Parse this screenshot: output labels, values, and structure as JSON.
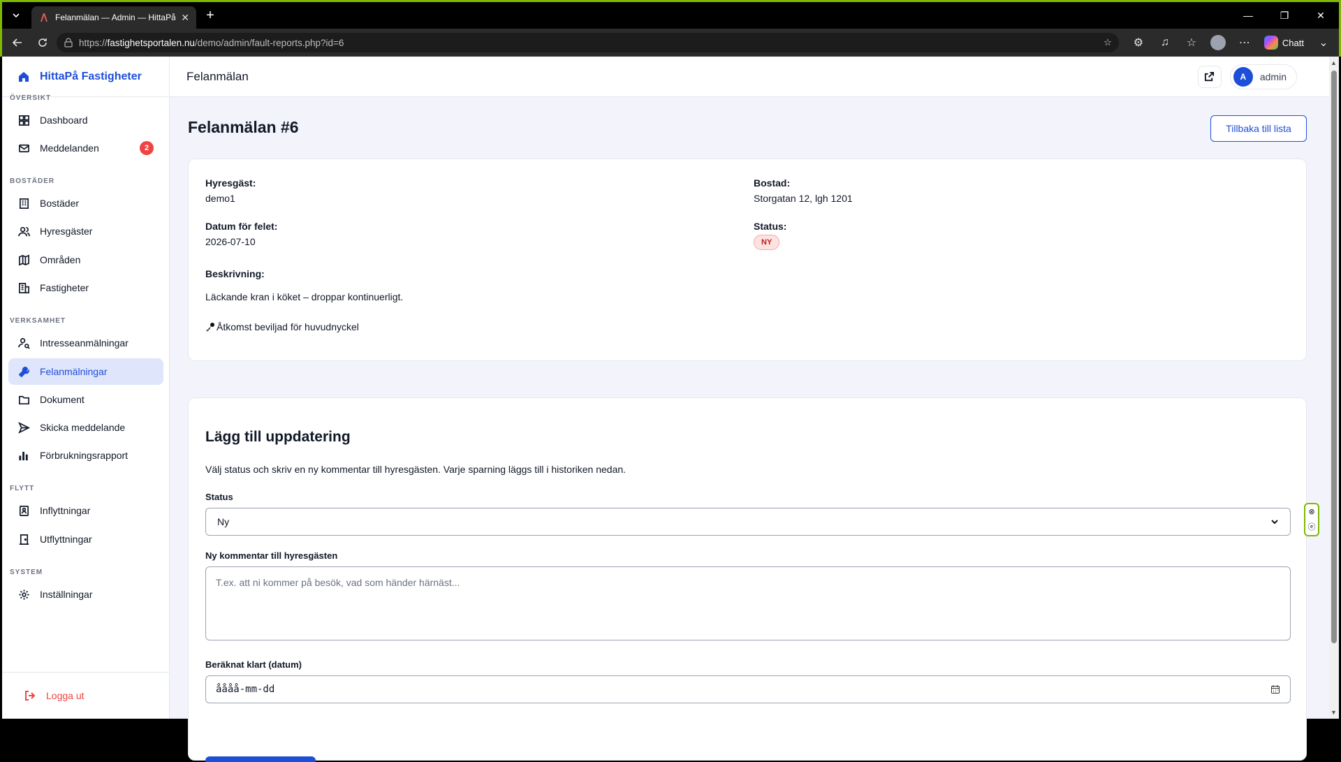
{
  "browser": {
    "tab_title": "Felanmälan — Admin — HittaPå Fa",
    "url_prefix": "https://",
    "url_host": "fastighetsportalen.nu",
    "url_path": "/demo/admin/fault-reports.php?id=6",
    "chatt_label": "Chatt"
  },
  "sidebar": {
    "brand": "HittaPå Fastigheter",
    "sections": {
      "oversikt": "ÖVERSIKT",
      "bostader": "BOSTÄDER",
      "verksamhet": "VERKSAMHET",
      "flytt": "FLYTT",
      "system": "SYSTEM"
    },
    "items": {
      "dashboard": "Dashboard",
      "meddelanden": "Meddelanden",
      "meddelanden_badge": "2",
      "bostader": "Bostäder",
      "hyresgaster": "Hyresgäster",
      "omraden": "Områden",
      "fastigheter": "Fastigheter",
      "intresse": "Intresseanmälningar",
      "felanmalningar": "Felanmälningar",
      "dokument": "Dokument",
      "skicka": "Skicka meddelande",
      "forbrukning": "Förbrukningsrapport",
      "inflyttningar": "Inflyttningar",
      "utflyttningar": "Utflyttningar",
      "installningar": "Inställningar"
    },
    "logout": "Logga ut"
  },
  "header": {
    "title": "Felanmälan",
    "user_initial": "A",
    "user_name": "admin"
  },
  "page": {
    "title": "Felanmälan #6",
    "back_button": "Tillbaka till lista"
  },
  "details": {
    "tenant_label": "Hyresgäst:",
    "tenant_value": "demo1",
    "residence_label": "Bostad:",
    "residence_value": "Storgatan 12, lgh 1201",
    "date_label": "Datum för felet:",
    "date_value": "2026-07-10",
    "status_label": "Status:",
    "status_value": "NY",
    "description_label": "Beskrivning:",
    "description_value": "Läckande kran i köket – droppar kontinuerligt.",
    "access_icon": "key-icon",
    "access_text": "Åtkomst beviljad för huvudnyckel"
  },
  "update_form": {
    "title": "Lägg till uppdatering",
    "help": "Välj status och skriv en ny kommentar till hyresgästen. Varje sparning läggs till i historiken nedan.",
    "status_label": "Status",
    "status_selected": "Ny",
    "comment_label": "Ny kommentar till hyresgästen",
    "comment_placeholder": "T.ex. att ni kommer på besök, vad som händer härnäst...",
    "eta_label": "Beräknat klart (datum)",
    "eta_placeholder": "åååå-mm-dd"
  },
  "colors": {
    "accent": "#1d4ed8",
    "danger": "#ef4444",
    "active_bg": "#dfe5fb"
  }
}
